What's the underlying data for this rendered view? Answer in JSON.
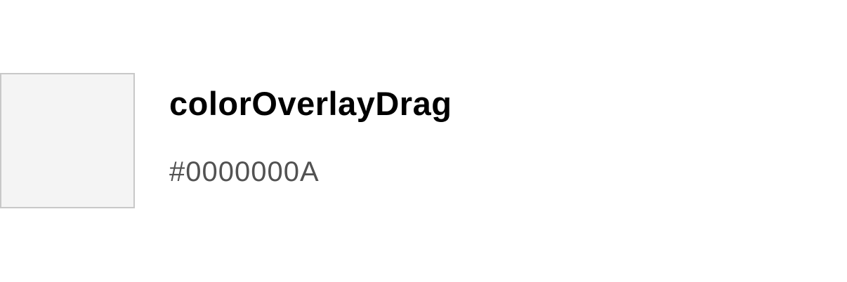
{
  "token": {
    "name": "colorOverlayDrag",
    "value": "#0000000A",
    "swatch_fill": "#f4f4f4",
    "swatch_border": "#c8c8c8"
  }
}
